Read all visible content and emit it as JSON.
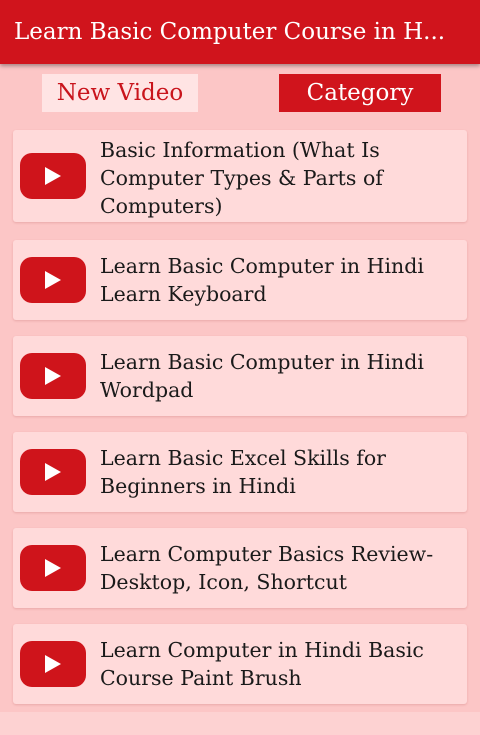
{
  "appbar": {
    "title": "Learn Basic Computer Course in H..."
  },
  "tabs": {
    "new_video": "New Video",
    "category": "Category"
  },
  "videos": [
    {
      "title": "Basic Information (What Is Computer Types & Parts of Computers)"
    },
    {
      "title": "Learn Basic Computer in Hindi Learn Keyboard"
    },
    {
      "title": "Learn Basic Computer in Hindi Wordpad"
    },
    {
      "title": "Learn Basic Excel Skills for Beginners in Hindi"
    },
    {
      "title": "Learn Computer Basics Review- Desktop, Icon, Shortcut"
    },
    {
      "title": "Learn Computer in Hindi Basic Course Paint Brush"
    }
  ],
  "colors": {
    "primary": "#d0141c",
    "background": "#fcc6c6",
    "card": "#ffdada"
  },
  "icons": {
    "video": "play-icon"
  }
}
